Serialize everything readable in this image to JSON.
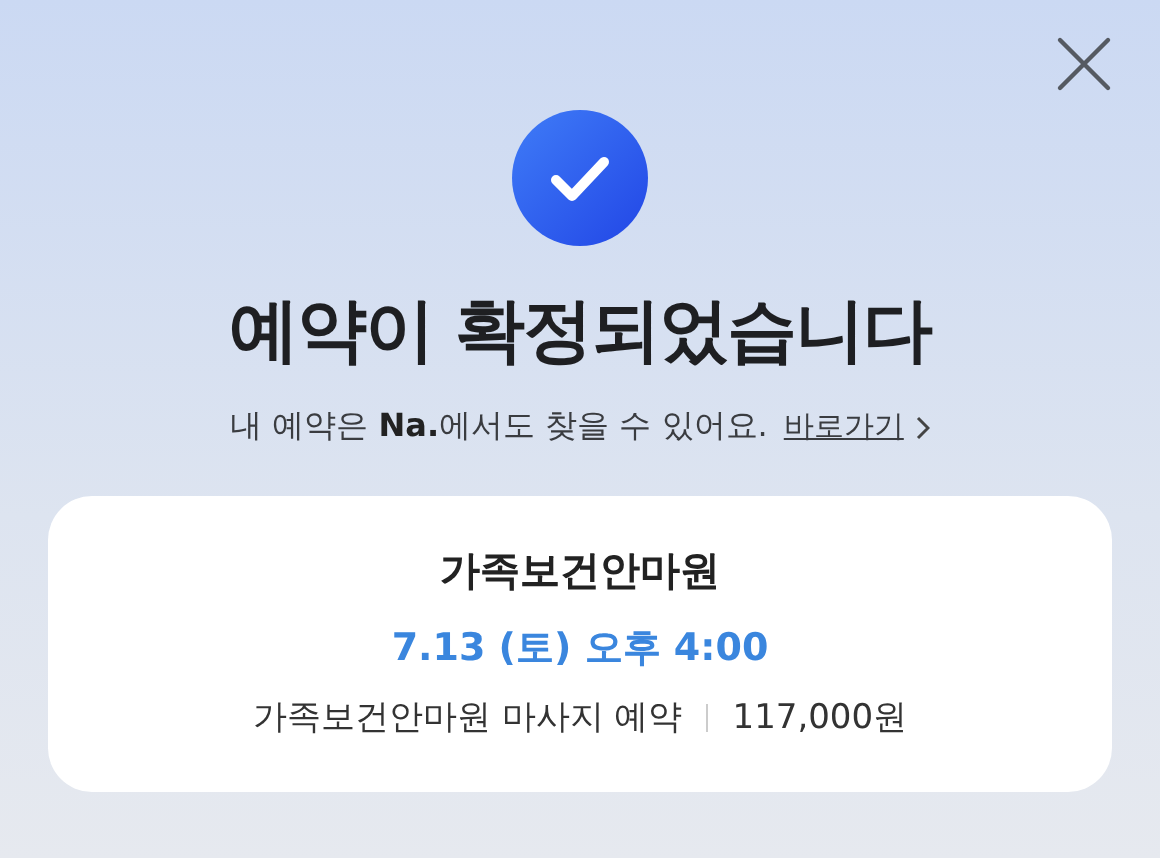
{
  "title": "예약이 확정되었습니다",
  "message": {
    "text": "내 예약은 **Na.**에서도 찾을 수 있어요.",
    "link": "바로가기"
  },
  "booking": {
    "place": "가족보건안마원",
    "datetime": "7.13 (토) 오후 4:00",
    "service": "가족보건안마원 마사지 예약",
    "price": "117,000원"
  }
}
